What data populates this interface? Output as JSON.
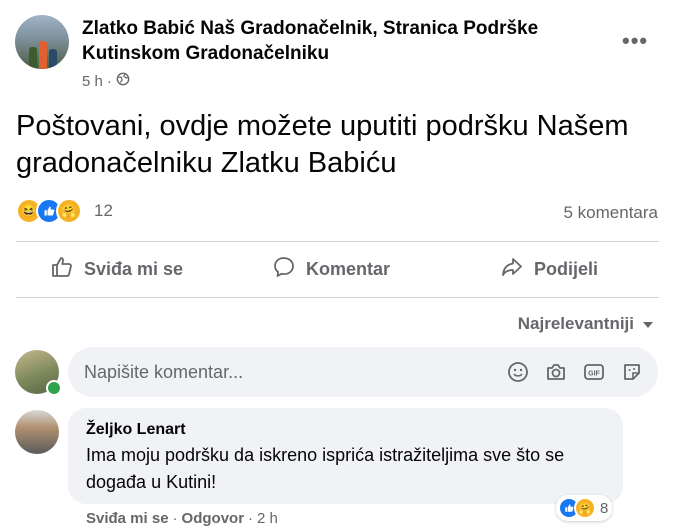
{
  "post": {
    "author": "Zlatko Babić Naš Gradonačelnik, Stranica Podrške Kutinskom Gradonačelniku",
    "time": "5 h",
    "privacy_icon": "globe-icon",
    "text": "Poštovani, ovdje možete uputiti podršku Našem gradonačelniku Zlatku Babiću",
    "reactions": {
      "icons": [
        "haha-icon",
        "like-icon",
        "care-icon"
      ],
      "count": "12"
    },
    "comment_count": "5 komentara"
  },
  "actions": {
    "like": "Sviđa mi se",
    "comment": "Komentar",
    "share": "Podijeli"
  },
  "sort_label": "Najrelevantniji",
  "composer": {
    "placeholder": "Napišite komentar...",
    "icons": [
      "emoji-icon",
      "camera-icon",
      "gif-icon",
      "sticker-icon"
    ]
  },
  "comments": [
    {
      "author": "Željko Lenart",
      "text": "Ima moju podršku da iskreno isprića istražiteljima sve što se događa u Kutini!",
      "reaction_count": "8",
      "like_label": "Sviđa mi se",
      "separator": "·",
      "reply_label": "Odgovor",
      "time": "2 h"
    }
  ],
  "colors": {
    "accent": "#1877f2",
    "secondary_text": "#65676b",
    "bubble": "#f0f2f5",
    "online": "#31a24c"
  }
}
